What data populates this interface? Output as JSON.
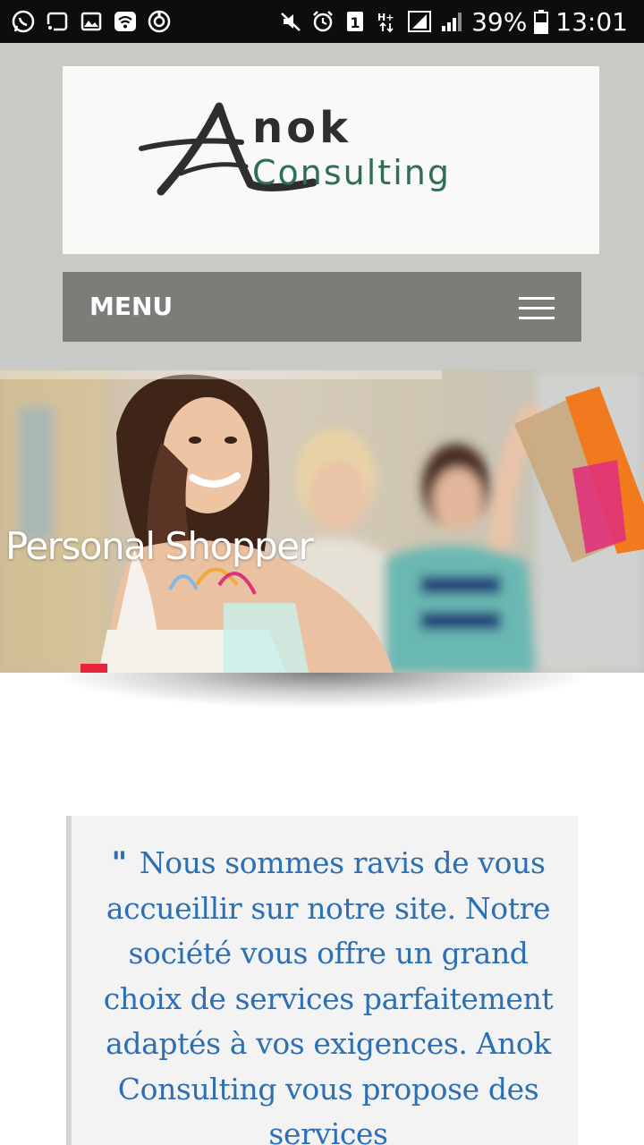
{
  "status_bar": {
    "left_icons": [
      "whatsapp-icon",
      "screen-cast-icon",
      "image-icon",
      "wifi-icon",
      "sync-icon"
    ],
    "right_icons": [
      "mute-icon",
      "alarm-icon",
      "sim-1-icon",
      "hplus-data-icon",
      "signal-icon",
      "signal-bars-icon",
      "battery-icon"
    ],
    "battery": "39%",
    "time": "13:01"
  },
  "header": {
    "logo_alt": "Anok Consulting",
    "logo_text_top": "nok",
    "logo_text_bottom": "Consulting",
    "background": "#c9c9c5"
  },
  "menu": {
    "label": "MENU",
    "icon": "hamburger-icon",
    "background": "#7c7c79"
  },
  "hero": {
    "title": "Personal Shopper"
  },
  "quote": {
    "mark": "\"",
    "text": "Nous sommes ravis de vous accueillir sur notre site. Notre société vous offre un grand choix de services parfaitement adaptés à vos exigences. Anok Consulting vous propose des services",
    "color": "#2c6fb3"
  }
}
